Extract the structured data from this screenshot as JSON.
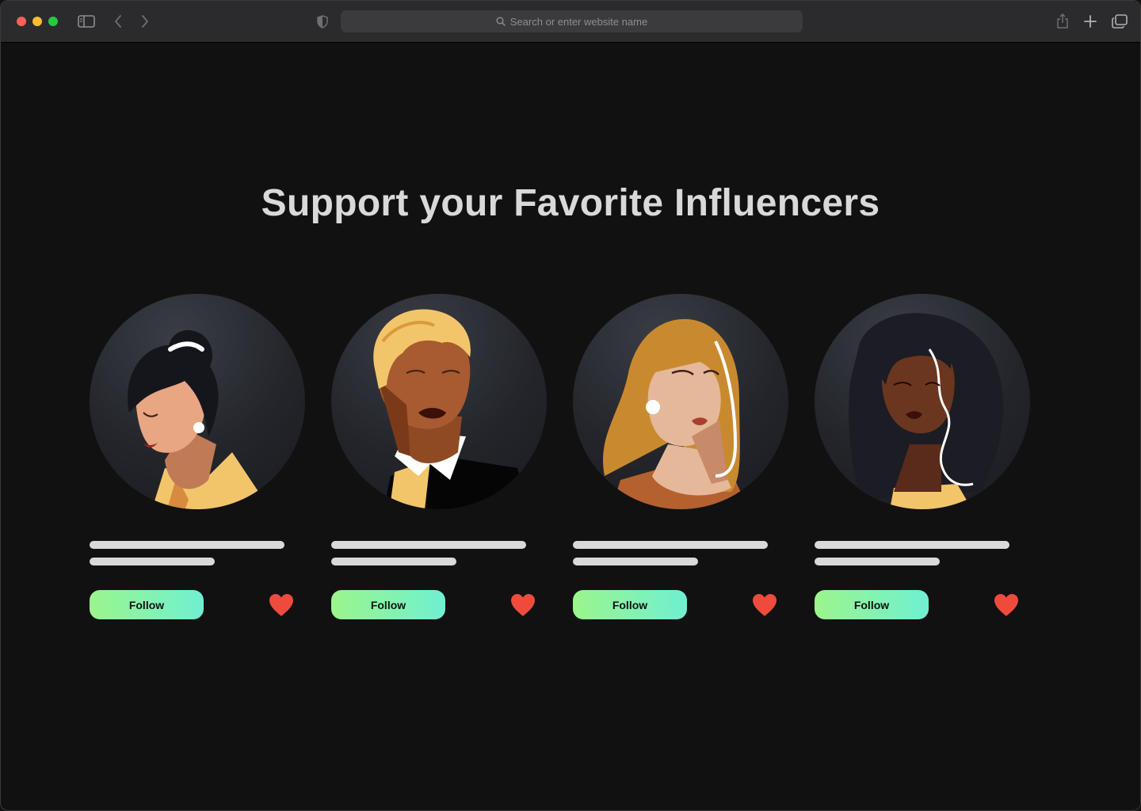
{
  "browser": {
    "address_placeholder": "Search or enter website name",
    "icons": [
      "sidebar-icon",
      "chevron-left-icon",
      "chevron-right-icon",
      "shield-icon",
      "search-icon",
      "share-icon",
      "plus-icon",
      "tabs-icon"
    ]
  },
  "page": {
    "title": "Support your Favorite Influencers"
  },
  "cards": [
    {
      "follow_label": "Follow",
      "icon": "heart-icon"
    },
    {
      "follow_label": "Follow",
      "icon": "heart-icon"
    },
    {
      "follow_label": "Follow",
      "icon": "heart-icon"
    },
    {
      "follow_label": "Follow",
      "icon": "heart-icon"
    }
  ],
  "colors": {
    "background": "#111111",
    "title": "#d9d9d9",
    "follow_gradient_start": "#9bf58c",
    "follow_gradient_end": "#6ff0d2",
    "heart": "#ef4b3c"
  }
}
